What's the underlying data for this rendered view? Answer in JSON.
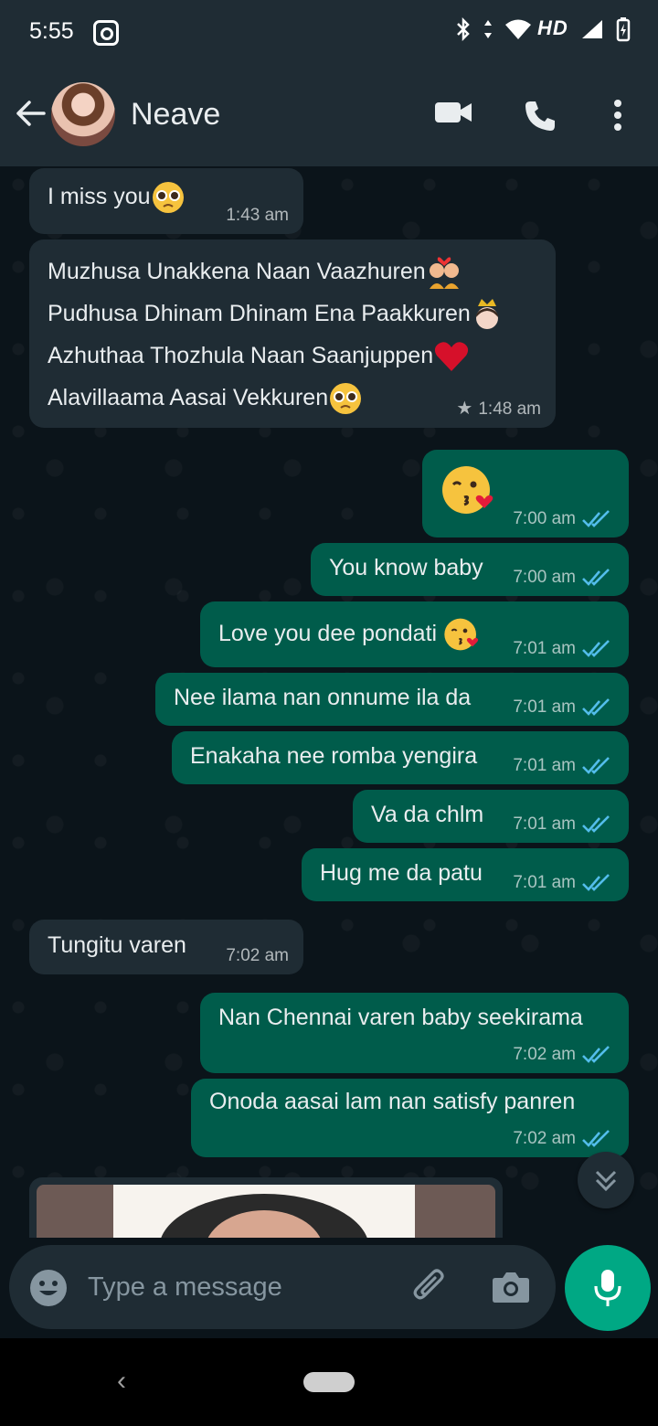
{
  "status_bar": {
    "time": "5:55",
    "network_label": "HD",
    "icons": [
      "instagram-icon",
      "bluetooth-icon",
      "data-arrows-icon",
      "wifi-icon",
      "signal-icon",
      "battery-icon"
    ]
  },
  "header": {
    "contact_name": "Neave",
    "icons": [
      "back-arrow-icon",
      "video-call-icon",
      "voice-call-icon",
      "more-options-icon"
    ]
  },
  "messages": [
    {
      "direction": "in",
      "text": "I miss you",
      "emoji": "pleading-face",
      "time": "1:43 am"
    },
    {
      "direction": "in",
      "lines": [
        {
          "text": "Muzhusa Unakkena Naan Vaazhuren",
          "emoji": "couple-with-heart"
        },
        {
          "text": "Pudhusa Dhinam Dhinam Ena Paakkuren",
          "emoji": "princess"
        },
        {
          "text": "Azhuthaa Thozhula Naan Saanjuppen",
          "emoji": "red-heart"
        },
        {
          "text": "Alavillaama Aasai Vekkuren",
          "emoji": "pleading-face"
        }
      ],
      "starred": true,
      "time": "1:48 am"
    },
    {
      "direction": "out",
      "text": "",
      "emoji": "face-blowing-kiss",
      "time": "7:00 am",
      "read": true
    },
    {
      "direction": "out",
      "text": "You know baby",
      "time": "7:00 am",
      "read": true
    },
    {
      "direction": "out",
      "text": "Love you dee pondati",
      "emoji": "face-blowing-kiss",
      "time": "7:01 am",
      "read": true
    },
    {
      "direction": "out",
      "text": "Nee ilama nan onnume ila da",
      "time": "7:01 am",
      "read": true
    },
    {
      "direction": "out",
      "text": "Enakaha nee romba yengira",
      "time": "7:01 am",
      "read": true
    },
    {
      "direction": "out",
      "text": "Va da chlm",
      "time": "7:01 am",
      "read": true
    },
    {
      "direction": "out",
      "text": "Hug me da patu",
      "time": "7:01 am",
      "read": true
    },
    {
      "direction": "in",
      "text": "Tungitu varen",
      "time": "7:02 am"
    },
    {
      "direction": "out",
      "text": "Nan Chennai varen baby seekirama",
      "time": "7:02 am",
      "read": true
    },
    {
      "direction": "out",
      "text": "Onoda aasai lam nan satisfy panren",
      "time": "7:02 am",
      "read": true
    }
  ],
  "input": {
    "placeholder": "Type a message",
    "icons": [
      "emoji-icon",
      "attach-icon",
      "camera-icon",
      "mic-icon"
    ]
  },
  "colors": {
    "incoming_bubble": "#1f2c34",
    "outgoing_bubble": "#005c4b",
    "read_ticks": "#53bdeb",
    "mic_button": "#00a884",
    "background": "#0b141a"
  }
}
